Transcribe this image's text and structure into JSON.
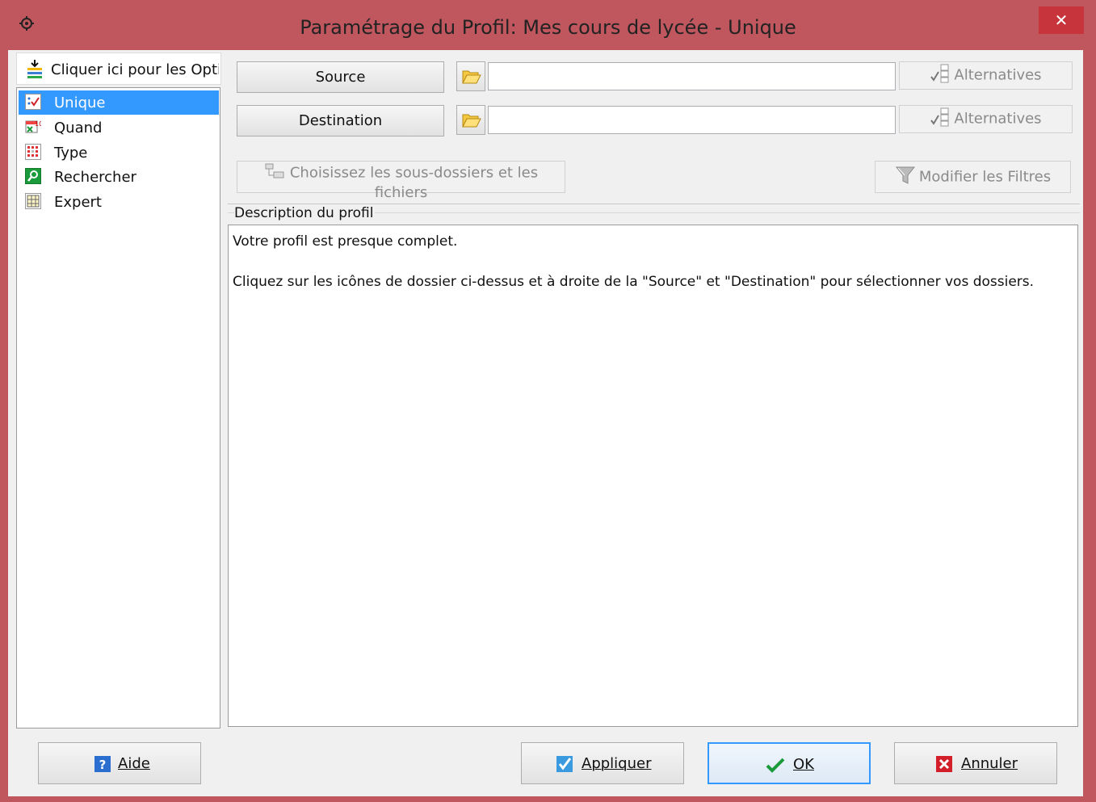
{
  "window": {
    "title": "Paramétrage du Profil: Mes cours de lycée - Unique",
    "close_symbol": "✕",
    "accent_color": "#c0575f"
  },
  "sidebar": {
    "options_header": "Cliquer ici pour les Opti",
    "items": [
      {
        "label": "Unique",
        "icon": "unique-checklist-icon",
        "selected": true
      },
      {
        "label": "Quand",
        "icon": "calendar-timer-icon",
        "selected": false
      },
      {
        "label": "Type",
        "icon": "type-grid-icon",
        "selected": false
      },
      {
        "label": "Rechercher",
        "icon": "search-magnifier-icon",
        "selected": false
      },
      {
        "label": "Expert",
        "icon": "expert-table-icon",
        "selected": false
      }
    ]
  },
  "paths": {
    "source_label": "Source",
    "source_value": "",
    "destination_label": "Destination",
    "destination_value": "",
    "alternatives_label": "Alternatives"
  },
  "actions": {
    "choose_subfolders_label": "Choisissez les sous-dossiers et les fichiers",
    "modify_filters_label": "Modifier les Filtres"
  },
  "description": {
    "heading": "Description du profil",
    "line1": "Votre profil est presque complet.",
    "line2": "Cliquez sur les icônes de dossier ci-dessus et à droite de la \"Source\" et \"Destination\" pour sélectionner vos dossiers."
  },
  "footer": {
    "help_label": "Aide",
    "apply_label": "Appliquer",
    "ok_label": "OK",
    "cancel_label": "Annuler"
  }
}
